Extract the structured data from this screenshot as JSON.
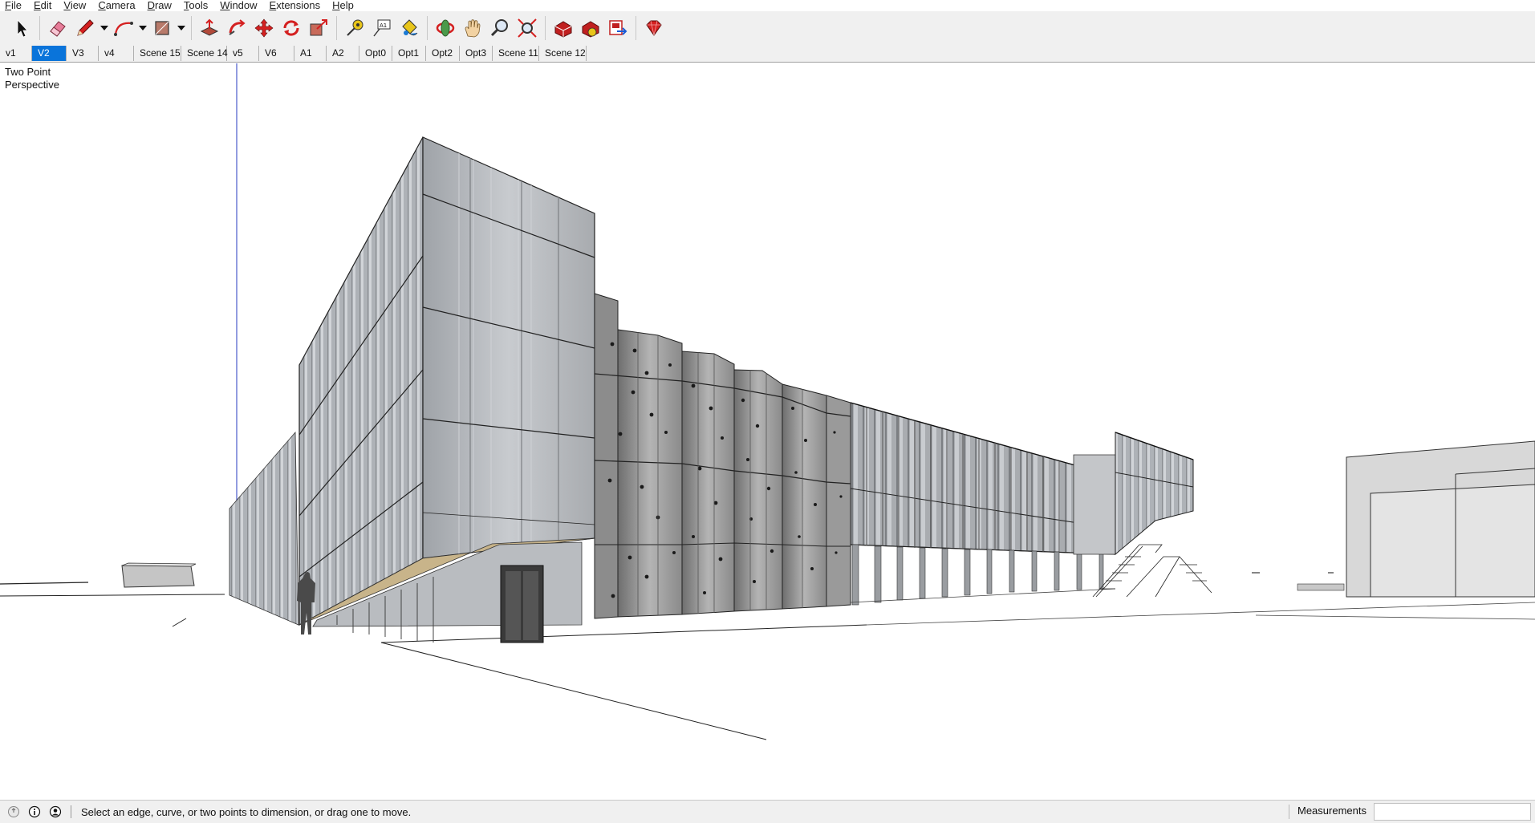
{
  "menu": [
    {
      "label": "File"
    },
    {
      "label": "Edit"
    },
    {
      "label": "View"
    },
    {
      "label": "Camera"
    },
    {
      "label": "Draw"
    },
    {
      "label": "Tools"
    },
    {
      "label": "Window"
    },
    {
      "label": "Extensions"
    },
    {
      "label": "Help"
    }
  ],
  "toolbar": {
    "tools": [
      "select",
      "eraser",
      "pencil",
      "arc",
      "shape",
      "push-pull",
      "follow-me",
      "move",
      "rotate",
      "scale",
      "tape-measure",
      "text",
      "paint-bucket",
      "orbit",
      "pan",
      "zoom",
      "zoom-extents",
      "3d-warehouse",
      "extension-warehouse",
      "layout",
      "extension-manager"
    ]
  },
  "scenes": {
    "active_index": 1,
    "tabs": [
      "v1",
      "V2",
      "V3",
      "v4",
      "Scene 15",
      "Scene 14",
      "v5",
      "V6",
      "A1",
      "A2",
      "Opt0",
      "Opt1",
      "Opt2",
      "Opt3",
      "Scene 11",
      "Scene 12"
    ]
  },
  "viewport": {
    "camera_label_line1": "Two Point",
    "camera_label_line2": "Perspective"
  },
  "status": {
    "message": "Select an edge, curve, or two points to dimension, or drag one to move.",
    "measurements_label": "Measurements",
    "measurements_value": ""
  },
  "colors": {
    "accent": "#0a74da",
    "toolbar_bg": "#f0f0f0",
    "icon_red": "#d42020",
    "facade_glass": "#b9bcc0",
    "facade_dark": "#4a4a4a"
  }
}
